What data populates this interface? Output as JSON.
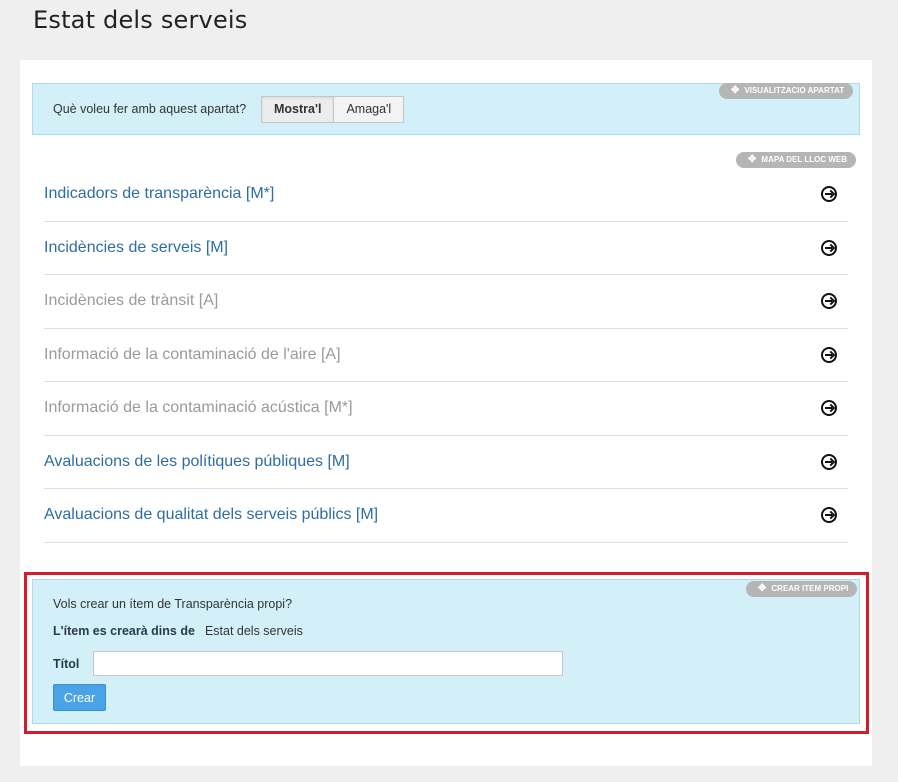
{
  "page": {
    "title": "Estat dels serveis"
  },
  "visualization": {
    "badge": "VISUALITZACIO APARTAT",
    "question": "Què voleu fer amb aquest apartat?",
    "show_label": "Mostra'l",
    "hide_label": "Amaga'l",
    "selected": "Mostra'l"
  },
  "sitemap": {
    "badge": "MAPA DEL LLOC WEB",
    "items": [
      {
        "label": "Indicadors de transparència [M*]",
        "enabled": true,
        "icon": "circle-arrow-right-icon"
      },
      {
        "label": "Incidències de serveis [M]",
        "enabled": true,
        "icon": "circle-arrow-right-icon"
      },
      {
        "label": "Incidències de trànsit [A]",
        "enabled": false,
        "icon": "circle-arrow-right-icon"
      },
      {
        "label": "Informació de la contaminació de l'aire [A]",
        "enabled": false,
        "icon": "circle-arrow-right-icon"
      },
      {
        "label": "Informació de la contaminació acústica [M*]",
        "enabled": false,
        "icon": "circle-arrow-right-icon"
      },
      {
        "label": "Avaluacions de les polítiques públiques [M]",
        "enabled": true,
        "icon": "circle-arrow-right-icon"
      },
      {
        "label": "Avaluacions de qualitat dels serveis públics [M]",
        "enabled": true,
        "icon": "circle-arrow-right-icon"
      }
    ]
  },
  "create_item": {
    "badge": "CREAR ITEM PROPI",
    "question": "Vols crear un ítem de Transparència propi?",
    "destination_label": "L'ítem es crearà dins de",
    "destination_value": "Estat dels serveis",
    "title_label": "Títol",
    "title_value": "",
    "submit_label": "Crear"
  },
  "colors": {
    "link": "#2e6da4",
    "disabled": "#9a9a9a",
    "panel_bg": "#d3f0f9",
    "highlight": "#d01e2b",
    "button": "#4aa3e6"
  }
}
